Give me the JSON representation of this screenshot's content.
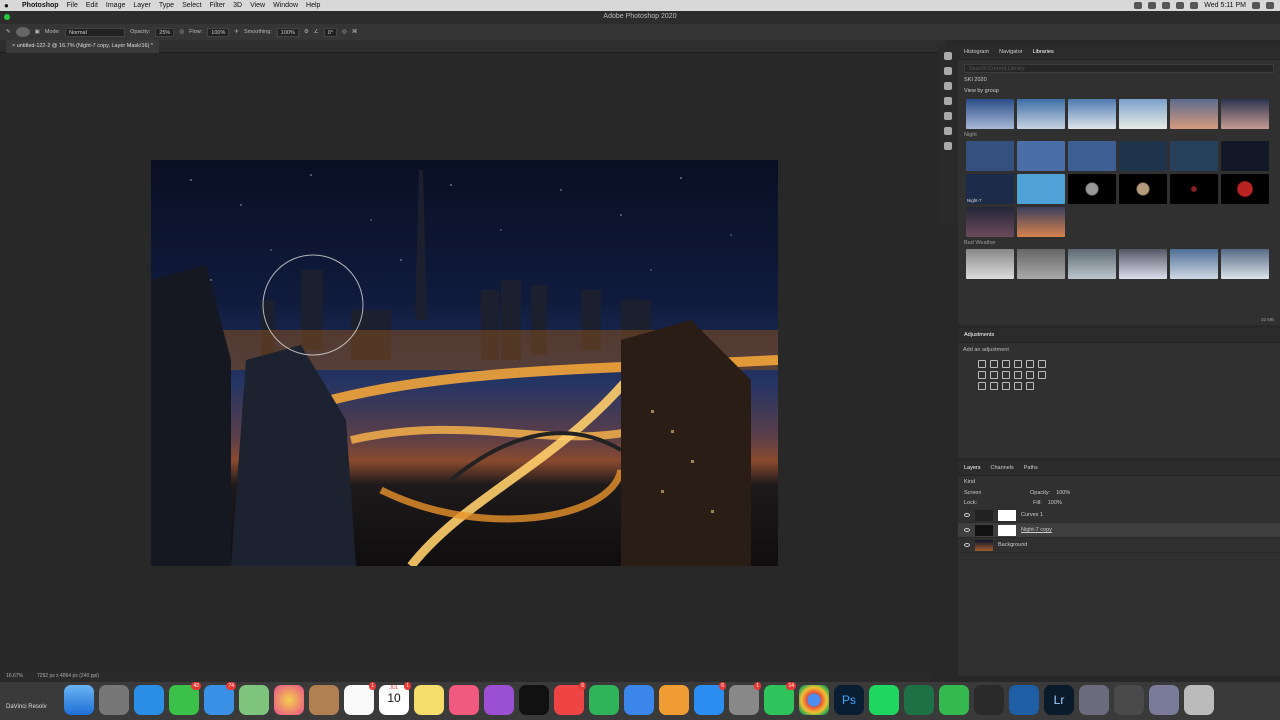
{
  "menubar": {
    "app_name": "Photoshop",
    "items": [
      "File",
      "Edit",
      "Image",
      "Layer",
      "Type",
      "Select",
      "Filter",
      "3D",
      "View",
      "Window",
      "Help"
    ],
    "window_title": "Adobe Photoshop 2020",
    "clock": "Wed 5:11 PM"
  },
  "options": {
    "mode_label": "Mode:",
    "mode_value": "Normal",
    "opacity_label": "Opacity:",
    "opacity_value": "25%",
    "flow_label": "Flow:",
    "flow_value": "100%",
    "smoothing_label": "Smoothing:",
    "smoothing_value": "100%",
    "angle_value": "0°"
  },
  "document": {
    "tab_title": "untitled-122-2 @ 16.7% (Night-7 copy, Layer Mask/16) *"
  },
  "statusbar": {
    "zoom": "16.67%",
    "size": "7292 px x 4864 px (240 ppi)"
  },
  "libraries": {
    "tabs": [
      "Histogram",
      "Navigator",
      "Libraries"
    ],
    "search_placeholder": "Search Current Library",
    "library_name": "SKI 2020",
    "view_by": "View by group",
    "groups": [
      "Night",
      "Bad Weather"
    ],
    "night_item_label": "Night-7",
    "storage": "32 MB"
  },
  "adjustments": {
    "title": "Adjustments",
    "subtitle": "Add an adjustment"
  },
  "layers": {
    "tabs": [
      "Layers",
      "Channels",
      "Paths"
    ],
    "filter_kind": "Kind",
    "blend_mode": "Screen",
    "opacity_label": "Opacity:",
    "opacity_value": "100%",
    "lock_label": "Lock:",
    "fill_label": "Fill:",
    "fill_value": "100%",
    "items": [
      {
        "name": "Curves 1"
      },
      {
        "name": "Night-7 copy"
      },
      {
        "name": "Background"
      }
    ]
  },
  "dock": {
    "resolve_label": "DaVinci Resolv",
    "calendar_month": "JUL",
    "calendar_day": "10",
    "badges": {
      "messages": "42",
      "mail": "74",
      "reminders": "1",
      "calendar": "1",
      "news": "6",
      "appstore": "6",
      "prefs": "1",
      "whatsapp": "14"
    }
  }
}
